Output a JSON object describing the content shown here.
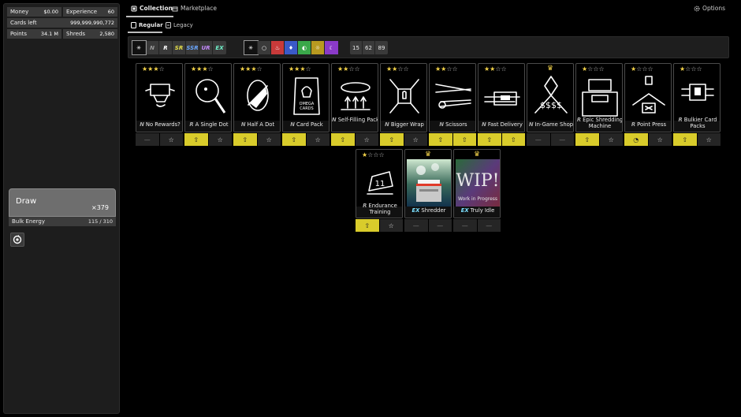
{
  "stats": {
    "money_label": "Money",
    "money": "$0.00",
    "exp_label": "Experience",
    "exp": "60",
    "cards_left_label": "Cards left",
    "cards_left": "999,999,990,772",
    "points_label": "Points",
    "points": "34.1 M",
    "shreds_label": "Shreds",
    "shreds": "2,580"
  },
  "draw": {
    "label": "Draw",
    "count": "×379"
  },
  "bulk": {
    "label": "Bulk Energy",
    "value": "115 / 310"
  },
  "nav": {
    "collection": "Collection",
    "marketplace": "Marketplace",
    "options": "Options"
  },
  "subnav": {
    "regular": "Regular",
    "legacy": "Legacy"
  },
  "filters": {
    "rarities": [
      "✳",
      "N",
      "R",
      "SR",
      "SSR",
      "UR",
      "EX"
    ],
    "rarity_colors": [
      "#ffffff",
      "#9a9a9a",
      "#ffffff",
      "#e6e04a",
      "#6aa7ff",
      "#c68cff",
      "#6ff0c8"
    ],
    "elements": [
      "✳",
      "○",
      "♨",
      "♦",
      "◐",
      "☼",
      "☾"
    ],
    "element_colors": [
      "#3a3a3a",
      "#3a3a3a",
      "#c83a3a",
      "#3a5ac8",
      "#3aa84a",
      "#b89a20",
      "#8a3ac8"
    ],
    "counts": [
      "15",
      "62",
      "89"
    ]
  },
  "cards": [
    {
      "stars": 3,
      "rarity": "N",
      "name": "No Rewards?",
      "btn1": "—",
      "btn2": "☆",
      "btn1_yellow": false
    },
    {
      "stars": 3,
      "rarity": "R",
      "name": "A Single Dot",
      "btn1": "⇧",
      "btn2": "☆",
      "btn1_yellow": true
    },
    {
      "stars": 3,
      "rarity": "N",
      "name": "Half A Dot",
      "btn1": "⇧",
      "btn2": "☆",
      "btn1_yellow": true
    },
    {
      "stars": 3,
      "rarity": "N",
      "name": "Card Pack",
      "btn1": "⇧",
      "btn2": "☆",
      "btn1_yellow": true
    },
    {
      "stars": 2,
      "rarity": "N",
      "name": "Self-Filling Pack",
      "btn1": "⇧",
      "btn2": "☆",
      "btn1_yellow": true
    },
    {
      "stars": 2,
      "rarity": "N",
      "name": "Bigger Wrap",
      "btn1": "⇧",
      "btn2": "☆",
      "btn1_yellow": true
    },
    {
      "stars": 2,
      "rarity": "N",
      "name": "Scissors",
      "btn1": "⇧",
      "btn2": "⇧",
      "btn1_yellow": true
    },
    {
      "stars": 2,
      "rarity": "N",
      "name": "Fast Delivery",
      "btn1": "⇧",
      "btn2": "⇧",
      "btn1_yellow": true
    },
    {
      "stars": 0,
      "crown": true,
      "rarity": "N",
      "name": "In-Game Shop",
      "btn1": "—",
      "btn2": "—",
      "btn1_yellow": false
    },
    {
      "stars": 1,
      "rarity": "R",
      "name": "Epic Shredding Machine",
      "btn1": "⇧",
      "btn2": "☆",
      "btn1_yellow": true
    },
    {
      "stars": 1,
      "rarity": "R",
      "name": "Point Press",
      "btn1": "◔",
      "btn2": "☆",
      "btn1_yellow": true
    },
    {
      "stars": 1,
      "rarity": "R",
      "name": "Bulkier Card Packs",
      "btn1": "⇧",
      "btn2": "☆",
      "btn1_yellow": true
    },
    {
      "stars": 1,
      "rarity": "R",
      "name": "Endurance Training",
      "btn1": "⇧",
      "btn2": "☆",
      "btn1_yellow": true
    },
    {
      "stars": 0,
      "crown": true,
      "rarity": "EX",
      "name": "Shredder",
      "btn1": "—",
      "btn2": "—",
      "btn1_yellow": false
    },
    {
      "stars": 0,
      "crown": true,
      "rarity": "EX",
      "name": "Truly Idle",
      "btn1": "—",
      "btn2": "—",
      "btn1_yellow": false
    }
  ],
  "wip": {
    "big": "WIP!",
    "small": "Work in Progress"
  },
  "pack_art": {
    "line1": "OMEGA",
    "line2": "CARDS"
  },
  "colors": {
    "accent_yellow": "#d9cc2b",
    "star_gold": "#f2d24a",
    "ex_cyan": "#7be0ff"
  }
}
